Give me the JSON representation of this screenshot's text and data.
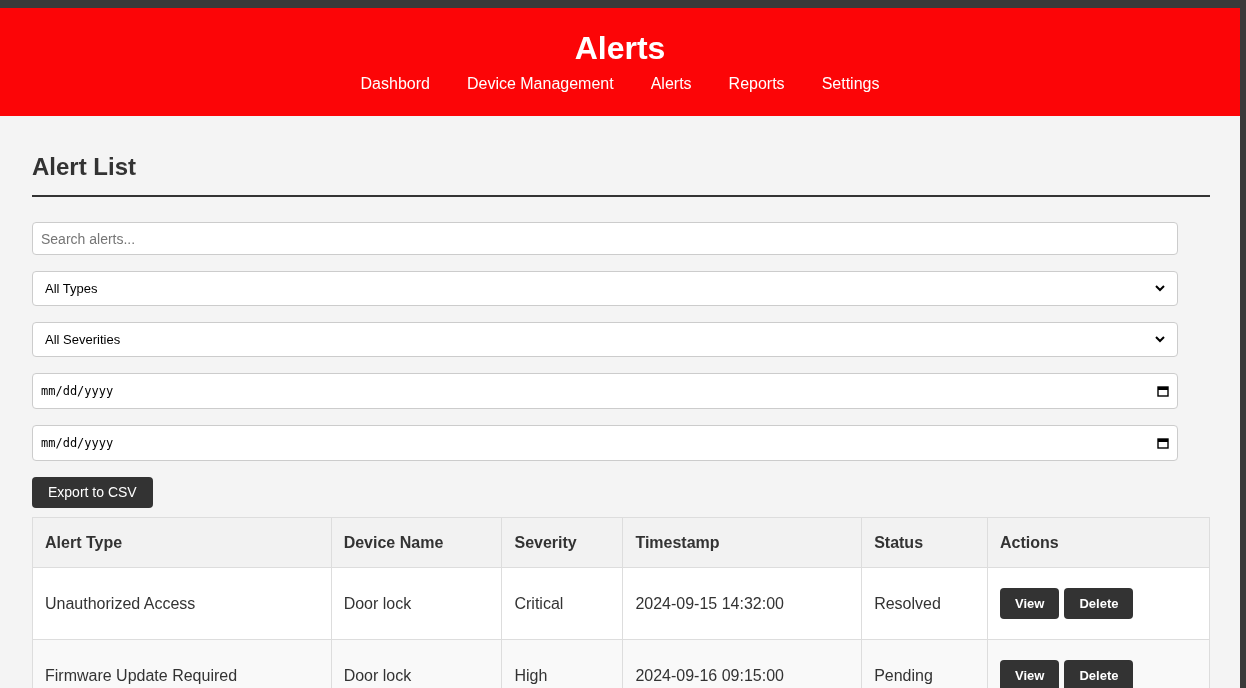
{
  "header": {
    "title": "Alerts",
    "nav": [
      {
        "label": "Dashbord"
      },
      {
        "label": "Device Management"
      },
      {
        "label": "Alerts"
      },
      {
        "label": "Reports"
      },
      {
        "label": "Settings"
      }
    ]
  },
  "section_title": "Alert List",
  "filters": [
    {
      "kind": "text",
      "placeholder": "Search alerts..."
    },
    {
      "kind": "select",
      "value": "All Types"
    },
    {
      "kind": "select",
      "value": "All Severities"
    },
    {
      "kind": "date",
      "placeholder": "mm/dd/yyyy"
    },
    {
      "kind": "date",
      "placeholder": "mm/dd/yyyy"
    }
  ],
  "export_button": "Export to CSV",
  "table": {
    "columns": [
      "Alert Type",
      "Device Name",
      "Severity",
      "Timestamp",
      "Status",
      "Actions"
    ],
    "rows": [
      {
        "cells": [
          "Unauthorized Access",
          "Door lock",
          "Critical",
          "2024-09-15 14:32:00",
          "Resolved"
        ],
        "actions": [
          "View",
          "Delete"
        ]
      },
      {
        "cells": [
          "Firmware Update Required",
          "Door lock",
          "High",
          "2024-09-16 09:15:00",
          "Pending"
        ],
        "actions": [
          "View",
          "Delete"
        ]
      }
    ]
  }
}
